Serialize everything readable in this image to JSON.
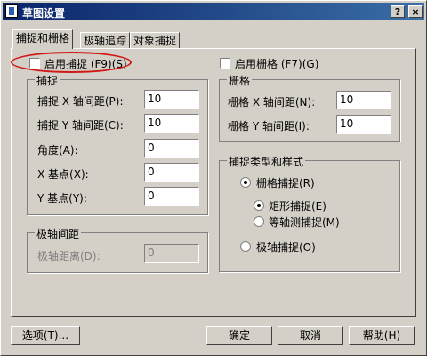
{
  "window": {
    "title": "草图设置",
    "help_glyph": "?",
    "close_glyph": "×"
  },
  "tabs": [
    "捕捉和栅格",
    "极轴追踪",
    "对象捕捉"
  ],
  "snap": {
    "enable_label": "启用捕捉 (F9)(S)",
    "group_title": "捕捉",
    "x_spacing_label": "捕捉 X 轴间距(P):",
    "x_spacing_value": "10",
    "y_spacing_label": "捕捉 Y 轴间距(C):",
    "y_spacing_value": "10",
    "angle_label": "角度(A):",
    "angle_value": "0",
    "x_base_label": "X 基点(X):",
    "x_base_value": "0",
    "y_base_label": "Y 基点(Y):",
    "y_base_value": "0"
  },
  "polar": {
    "group_title": "极轴间距",
    "distance_label": "极轴距离(D):",
    "distance_value": "0"
  },
  "grid": {
    "enable_label": "启用栅格 (F7)(G)",
    "group_title": "栅格",
    "x_spacing_label": "栅格 X 轴间距(N):",
    "x_spacing_value": "10",
    "y_spacing_label": "栅格 Y 轴间距(I):",
    "y_spacing_value": "10"
  },
  "snap_type": {
    "group_title": "捕捉类型和样式",
    "grid_snap_label": "栅格捕捉(R)",
    "rect_snap_label": "矩形捕捉(E)",
    "iso_snap_label": "等轴测捕捉(M)",
    "polar_snap_label": "极轴捕捉(O)"
  },
  "buttons": {
    "options": "选项(T)...",
    "ok": "确定",
    "cancel": "取消",
    "help": "帮助(H)"
  }
}
